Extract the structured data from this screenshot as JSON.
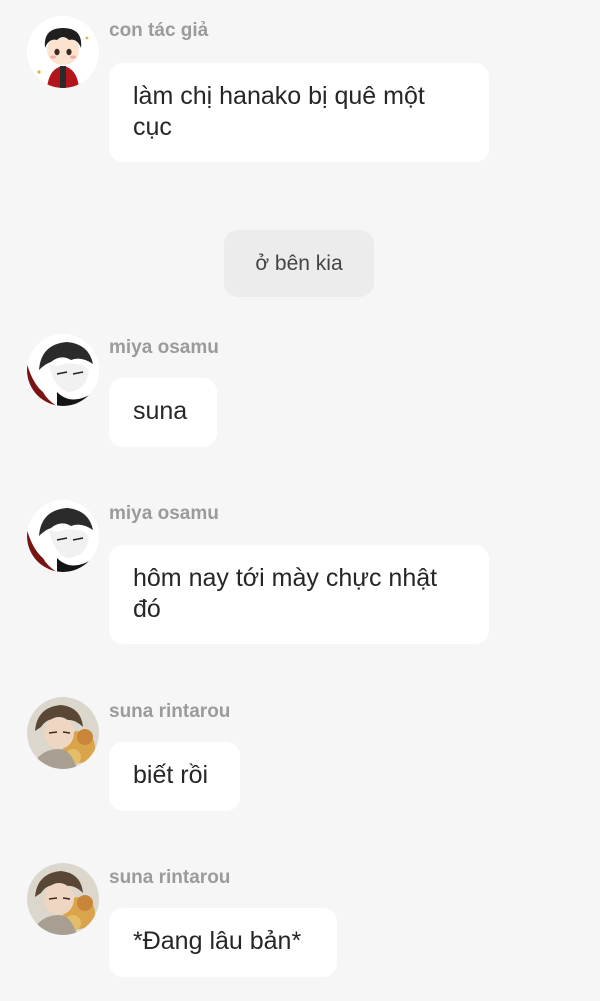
{
  "messages": [
    {
      "sender": "con tác giả",
      "text": "làm chị hanako bị quê một cục",
      "avatar": "chibi-author-avatar"
    },
    {
      "sender": "miya osamu",
      "text": "suna",
      "avatar": "osamu-avatar"
    },
    {
      "sender": "miya osamu",
      "text": "hôm nay tới mày chực nhật đó",
      "avatar": "osamu-avatar"
    },
    {
      "sender": "suna rintarou",
      "text": "biết rồi",
      "avatar": "suna-avatar"
    },
    {
      "sender": "suna rintarou",
      "text": "*Đang lâu bản*",
      "avatar": "suna-avatar"
    }
  ],
  "system_notice": "ở bên kia",
  "colors": {
    "background": "#f6f6f6",
    "bubble": "#ffffff",
    "system_bubble": "#ececec",
    "sender_text": "#9b9b9b",
    "message_text": "#262626"
  }
}
